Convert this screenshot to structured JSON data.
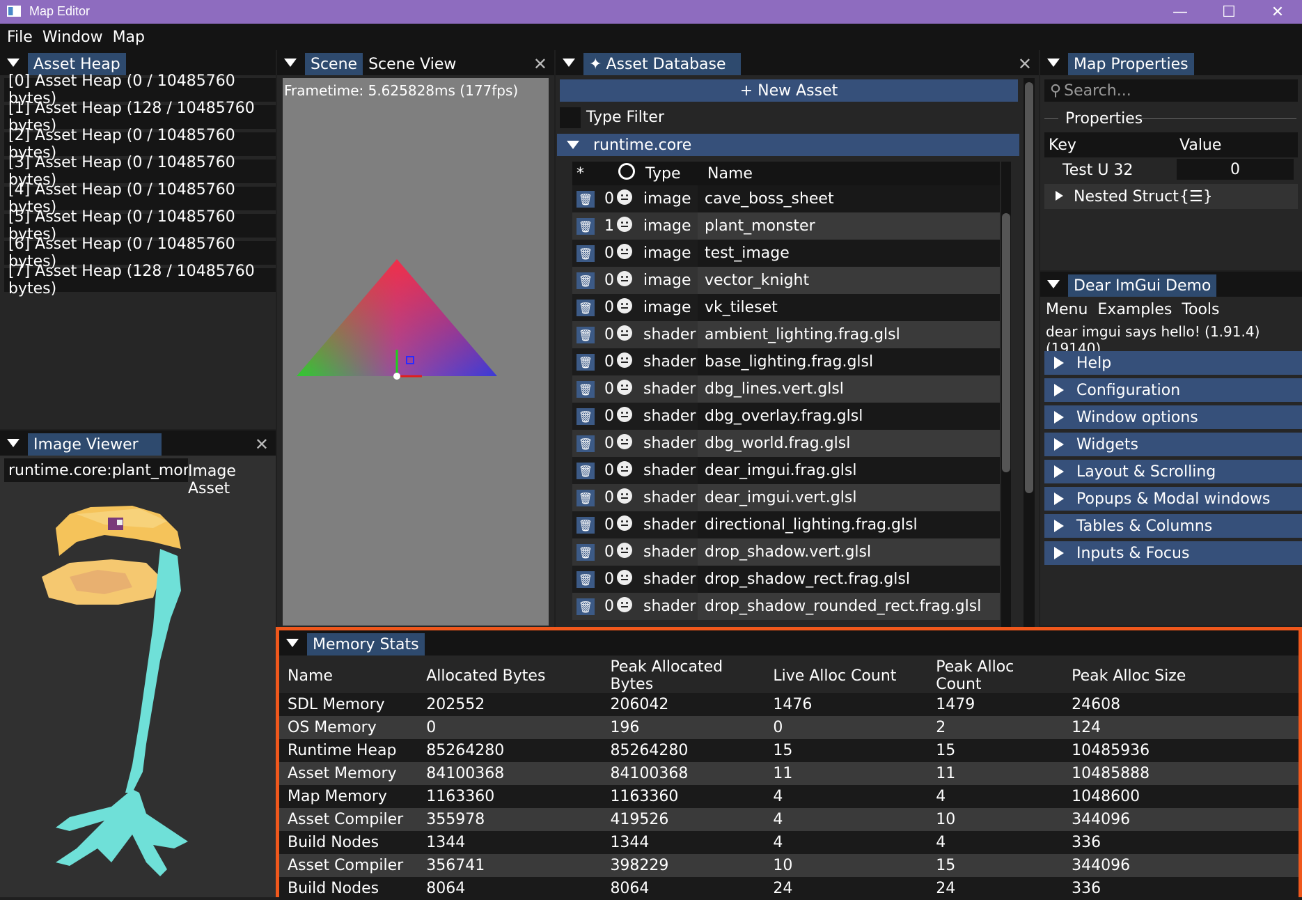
{
  "window": {
    "title": "Map Editor",
    "minimize": "—",
    "maximize": "☐",
    "close": "✕"
  },
  "menubar": [
    "File",
    "Window",
    "Map"
  ],
  "asset_heap": {
    "tab": "Asset Heap",
    "items": [
      "[0] Asset Heap (0 / 10485760 bytes)",
      "[1] Asset Heap (128 / 10485760 bytes)",
      "[2] Asset Heap (0 / 10485760 bytes)",
      "[3] Asset Heap (0 / 10485760 bytes)",
      "[4] Asset Heap (0 / 10485760 bytes)",
      "[5] Asset Heap (0 / 10485760 bytes)",
      "[6] Asset Heap (0 / 10485760 bytes)",
      "[7] Asset Heap (128 / 10485760 bytes)"
    ]
  },
  "image_viewer": {
    "tab": "Image Viewer",
    "path": "runtime.core:plant_monst",
    "label": "Image Asset"
  },
  "scene": {
    "tab1": "Scene",
    "tab2": "Scene View",
    "frametime": "Frametime: 5.625828ms (177fps)"
  },
  "asset_db": {
    "tab": "Asset Database",
    "new_asset": "+ New Asset",
    "type_filter": "Type Filter",
    "group": "runtime.core",
    "col_star": "*",
    "col_type": "Type",
    "col_name": "Name",
    "rows": [
      {
        "count": "0",
        "type": "image",
        "name": "cave_boss_sheet"
      },
      {
        "count": "1",
        "type": "image",
        "name": "plant_monster"
      },
      {
        "count": "0",
        "type": "image",
        "name": "test_image"
      },
      {
        "count": "0",
        "type": "image",
        "name": "vector_knight"
      },
      {
        "count": "0",
        "type": "image",
        "name": "vk_tileset"
      },
      {
        "count": "0",
        "type": "shader",
        "name": "ambient_lighting.frag.glsl"
      },
      {
        "count": "0",
        "type": "shader",
        "name": "base_lighting.frag.glsl"
      },
      {
        "count": "0",
        "type": "shader",
        "name": "dbg_lines.vert.glsl"
      },
      {
        "count": "0",
        "type": "shader",
        "name": "dbg_overlay.frag.glsl"
      },
      {
        "count": "0",
        "type": "shader",
        "name": "dbg_world.frag.glsl"
      },
      {
        "count": "0",
        "type": "shader",
        "name": "dear_imgui.frag.glsl"
      },
      {
        "count": "0",
        "type": "shader",
        "name": "dear_imgui.vert.glsl"
      },
      {
        "count": "0",
        "type": "shader",
        "name": "directional_lighting.frag.glsl"
      },
      {
        "count": "0",
        "type": "shader",
        "name": "drop_shadow.vert.glsl"
      },
      {
        "count": "0",
        "type": "shader",
        "name": "drop_shadow_rect.frag.glsl"
      },
      {
        "count": "0",
        "type": "shader",
        "name": "drop_shadow_rounded_rect.frag.glsl"
      }
    ]
  },
  "map_props": {
    "tab": "Map Properties",
    "search_placeholder": "Search...",
    "section": "Properties",
    "col_key": "Key",
    "col_value": "Value",
    "test_key": "Test U 32",
    "test_value": "0",
    "nested_key": "Nested Struct",
    "nested_value": "{☰}"
  },
  "demo": {
    "tab": "Dear ImGui Demo",
    "menu": [
      "Menu",
      "Examples",
      "Tools"
    ],
    "hello": "dear imgui says hello! (1.91.4) (19140)",
    "sections": [
      "Help",
      "Configuration",
      "Window options",
      "Widgets",
      "Layout & Scrolling",
      "Popups & Modal windows",
      "Tables & Columns",
      "Inputs & Focus"
    ]
  },
  "memory": {
    "tab": "Memory Stats",
    "headers": [
      "Name",
      "Allocated Bytes",
      "Peak Allocated Bytes",
      "Live Alloc Count",
      "Peak Alloc Count",
      "Peak Alloc Size"
    ],
    "rows": [
      [
        "SDL Memory",
        "202552",
        "206042",
        "1476",
        "1479",
        "24608"
      ],
      [
        "OS Memory",
        "0",
        "196",
        "0",
        "2",
        "124"
      ],
      [
        "Runtime Heap",
        "85264280",
        "85264280",
        "15",
        "15",
        "10485936"
      ],
      [
        "Asset Memory",
        "84100368",
        "84100368",
        "11",
        "11",
        "10485888"
      ],
      [
        "Map Memory",
        "1163360",
        "1163360",
        "4",
        "4",
        "1048600"
      ],
      [
        "Asset Compiler",
        "355978",
        "419526",
        "4",
        "10",
        "344096"
      ],
      [
        "Build Nodes",
        "1344",
        "1344",
        "4",
        "4",
        "336"
      ],
      [
        "Asset Compiler",
        "356741",
        "398229",
        "10",
        "15",
        "344096"
      ],
      [
        "Build Nodes",
        "8064",
        "8064",
        "24",
        "24",
        "336"
      ]
    ]
  },
  "colors": {
    "title_bar": "#8e6cbf",
    "highlight": "#f0581c",
    "tab_active": "#2e4a6e"
  }
}
